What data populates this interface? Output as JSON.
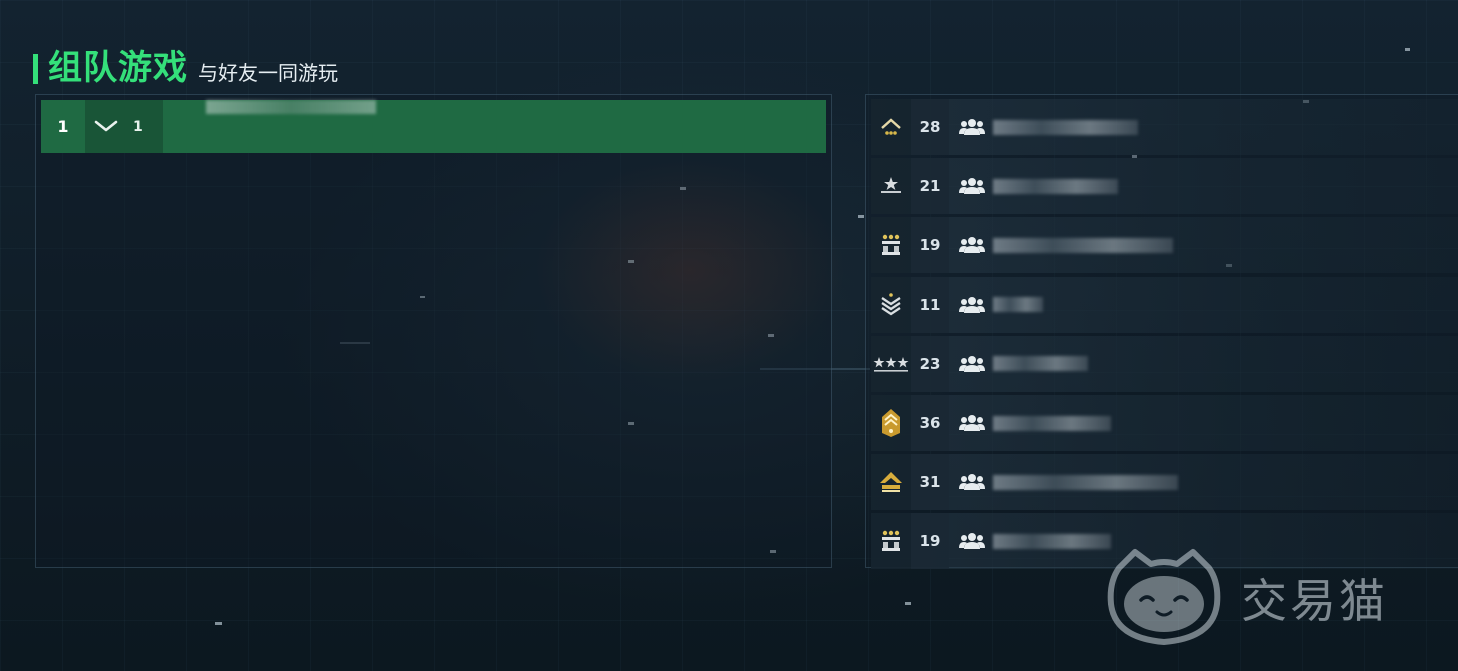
{
  "header": {
    "title": "组队游戏",
    "subtitle": "与好友一同游玩"
  },
  "team": {
    "index": "1",
    "member_count": "1",
    "chevron_icon": "chevron-down-icon"
  },
  "players": [
    {
      "level": "28",
      "rank_icon": "rank-chevron-stars-icon",
      "name_width": 145
    },
    {
      "level": "21",
      "rank_icon": "rank-star-bar-icon",
      "name_width": 125
    },
    {
      "level": "19",
      "rank_icon": "rank-three-dots-bars-icon",
      "name_width": 180
    },
    {
      "level": "11",
      "rank_icon": "rank-triple-chevron-icon",
      "name_width": 50
    },
    {
      "level": "23",
      "rank_icon": "rank-three-stars-icon",
      "name_width": 95
    },
    {
      "level": "36",
      "rank_icon": "rank-gold-chevron-icon",
      "name_width": 118
    },
    {
      "level": "31",
      "rank_icon": "rank-gold-arrow-icon",
      "name_width": 185
    },
    {
      "level": "19",
      "rank_icon": "rank-three-dots-bars-icon",
      "name_width": 118
    }
  ],
  "watermark": {
    "text": "交易猫"
  },
  "colors": {
    "accent": "#34e07a",
    "team_row": "#1f6a43",
    "background": "#0f1c26"
  }
}
